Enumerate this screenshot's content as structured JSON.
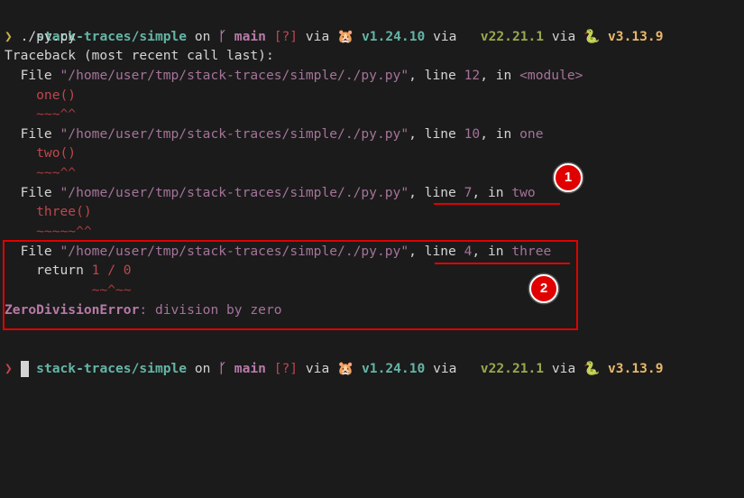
{
  "prompt": {
    "dir": "stack-traces/simple",
    "on": " on ",
    "branch_icon": "git-branch-icon",
    "branch_glyph": "ᚴ",
    "branch": " main",
    "status": " [?]",
    "via1": " via ",
    "go_icon": "🐹",
    "go_version": " v1.24.10",
    "via2": " via ",
    "node_version": "  v22.21.1",
    "via3": " via ",
    "py_icon": "🐍",
    "py_version": " v3.13.9",
    "chevron": "❯"
  },
  "command": " ./py.py",
  "traceback": {
    "header": "Traceback (most recent call last):",
    "frames": [
      {
        "file_kw": "  File ",
        "path": "\"/home/user/tmp/stack-traces/simple/./py.py\"",
        "comma": ", line ",
        "line": "12",
        "in": ", in ",
        "func": "<module>",
        "code": "    one()",
        "marker": "    ~~~^^"
      },
      {
        "file_kw": "  File ",
        "path": "\"/home/user/tmp/stack-traces/simple/./py.py\"",
        "comma": ", line ",
        "line": "10",
        "in": ", in ",
        "func": "one",
        "code": "    two()",
        "marker": "    ~~~^^"
      },
      {
        "file_kw": "  File ",
        "path": "\"/home/user/tmp/stack-traces/simple/./py.py\"",
        "comma": ", line ",
        "line": "7",
        "in": ", in ",
        "func": "two",
        "code": "    three()",
        "marker": "    ~~~~~^^"
      },
      {
        "file_kw": "  File ",
        "path": "\"/home/user/tmp/stack-traces/simple/./py.py\"",
        "comma": ", line ",
        "line": "4",
        "in": ", in ",
        "func": "three",
        "code_kw": "    return ",
        "code": "1 / 0",
        "marker": "           ~~^~~"
      }
    ],
    "error_type": "ZeroDivisionError",
    "error_msg": ": division by zero"
  },
  "annotations": {
    "badge1": "1",
    "badge2": "2"
  }
}
